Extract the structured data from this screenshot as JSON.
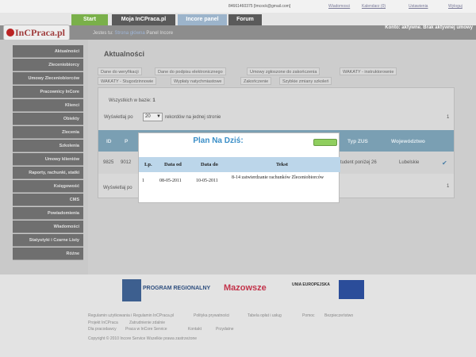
{
  "topbar": {
    "user": "84661460375 [lmcock@gmail.com]",
    "links": [
      "Wiadomosci",
      "Kalendarz (0)",
      "Ustawienia",
      "Wyloguj"
    ]
  },
  "tabs": [
    {
      "label": "Start",
      "color": "#7ab04a"
    },
    {
      "label": "Moja InCPraca.pl",
      "color": "#5a5a5a"
    },
    {
      "label": "Incore panel",
      "color": "#9cb4cb"
    },
    {
      "label": "Forum",
      "color": "#5a5a5a"
    }
  ],
  "logo": "InCPraca.pl",
  "breadcrumb": {
    "prefix": "Jestes tu:",
    "link": "Strona główna",
    "current": "Panel Incore"
  },
  "konto": "Konto: aktywne. Brak aktywnej umowy",
  "sidebar": [
    "Aktualności",
    "Zleceniobiorcy",
    "Umowy Zleceniobiorców",
    "Pracownicy InCore",
    "Klienci",
    "Obiekty",
    "Zlecenia",
    "Szkolenia",
    "Umowy klientów",
    "Raporty, rachunki, statki",
    "Księgowość",
    "CMS",
    "Powiadomienia",
    "Wiadomości",
    "Statystyki i Czarne Listy",
    "Różne"
  ],
  "main": {
    "title": "Aktualności",
    "tabs_row1": [
      "Dane do weryfikacji",
      "Dane do podpisu elektronicznego",
      "Umowy zgłoszone do zakończenia",
      "WAKATY - instruktorownie"
    ],
    "tabs_row2": [
      "WAKATY - Stugodzinnowie",
      "Wypłaty natychmiastowe",
      "Zakończenie",
      "Szybkie zmiany szkoleń"
    ],
    "count_label": "Wszystkich w bazie:",
    "count": "1",
    "perpage_prefix": "Wyświetlaj po",
    "perpage_value": "20",
    "perpage_suffix": "rekordów na jednej stronie",
    "page": "1",
    "headers": [
      "ID",
      "P",
      "Typ ZUS",
      "Województwo"
    ],
    "row": {
      "id": "9825",
      "p": "9012",
      "zus": "Student poniżej 26",
      "woj": "Lubelskie"
    },
    "perpage_bottom": "Wyświetlaj po"
  },
  "footer": {
    "logos": [
      "PROGRAM REGIONALNY",
      "Mazowsze",
      "UNIA EUROPEJSKA"
    ],
    "links": [
      "Regulamin użytkowania i Regulamin InCPraca.pl",
      "Polityka prywatności",
      "Tabela opłat i usług",
      "Pomoc",
      "Bezpieczeństwo",
      "Projekt InCPraca",
      "Zatrudnienie zdalnie",
      "Dla pracodawcy",
      "Praca w InCore Service",
      "Kontakt",
      "Przydatne"
    ],
    "copyright": "Copyright © 2010 Incore Service Wszelkie prawa zastrzeżone"
  },
  "modal": {
    "title": "Plan Na Dziś:",
    "headers": [
      "Lp.",
      "Data od",
      "Data do",
      "Tekst"
    ],
    "row": {
      "lp": "1",
      "from": "08-05-2011",
      "to": "10-05-2011",
      "text": "8-14 zatwierdzanie rachunków Zleceniobiorców"
    }
  }
}
